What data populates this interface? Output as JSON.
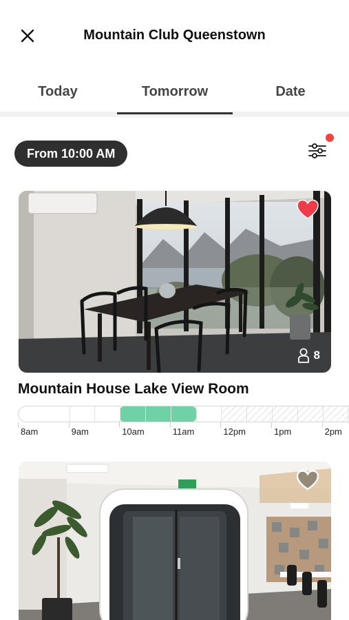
{
  "header": {
    "title": "Mountain Club Queenstown"
  },
  "tabs": [
    {
      "label": "Today"
    },
    {
      "label": "Tomorrow",
      "active": true
    },
    {
      "label": "Date"
    }
  ],
  "filters": {
    "time_chip": "From 10:00 AM",
    "has_active_filter": true
  },
  "rooms": [
    {
      "name": "Mountain House Lake View Room",
      "capacity": "8",
      "favorited": true,
      "timeline": {
        "hours": [
          "8am",
          "9am",
          "10am",
          "11am",
          "12pm",
          "1pm",
          "2pm"
        ],
        "booked_from_hour": 10,
        "booked_to_hour": 11.5,
        "unavailable_from_hour": 12
      }
    },
    {
      "favorited": false
    }
  ],
  "colors": {
    "booked": "#6fd1a6",
    "heart_active": "#ef3b4a",
    "notification_dot": "#f0443e",
    "chip_bg": "#2f2f2f"
  }
}
